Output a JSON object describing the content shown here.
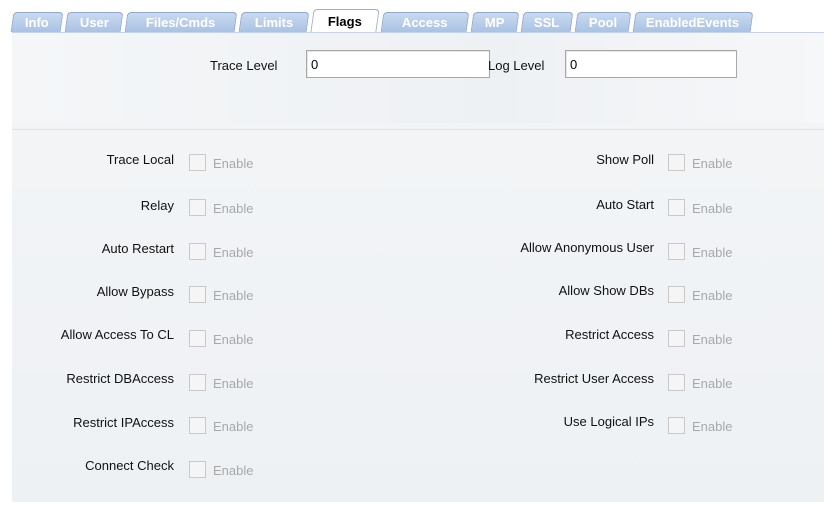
{
  "tabs": [
    "Info",
    "User",
    "Files/Cmds",
    "Limits",
    "Flags",
    "Access",
    "MP",
    "SSL",
    "Pool",
    "EnabledEvents"
  ],
  "active_tab": "Flags",
  "fields": {
    "trace_level": {
      "label": "Trace Level",
      "value": "0"
    },
    "log_level": {
      "label": "Log Level",
      "value": "0"
    }
  },
  "checkbox_text": "Enable",
  "left_flags": [
    "Trace Local",
    "Relay",
    "Auto Restart",
    "Allow Bypass",
    "Allow Access To CL",
    "Restrict DBAccess",
    "Restrict IPAccess",
    "Connect Check"
  ],
  "right_flags": [
    "Show Poll",
    "Auto Start",
    "Allow Anonymous User",
    "Allow Show DBs",
    "Restrict Access",
    "Restrict User Access",
    "Use Logical IPs"
  ],
  "colors": {
    "tab_fill": "#a9c2e4",
    "tab_text": "#ffffff",
    "disabled_text": "#a8a8a8",
    "panel_bg": "#eef1f4"
  }
}
